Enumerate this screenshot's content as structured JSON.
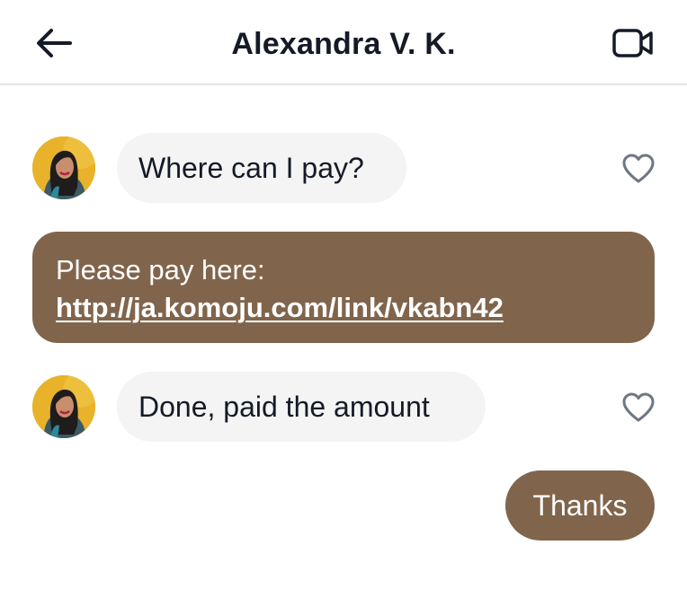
{
  "header": {
    "title": "Alexandra V. K.",
    "back_icon": "arrow-left-icon",
    "video_icon": "video-camera-icon"
  },
  "messages": [
    {
      "direction": "incoming",
      "text": "Where can I pay?"
    },
    {
      "direction": "outgoing",
      "text": "Please pay here:",
      "link": "http://ja.komoju.com/link/vkabn42"
    },
    {
      "direction": "incoming",
      "text": "Done, paid the amount"
    },
    {
      "direction": "outgoing",
      "text": "Thanks"
    }
  ],
  "colors": {
    "outgoing_bubble": "#80654c",
    "incoming_bubble": "#f4f4f5",
    "text": "#141a26",
    "icon": "#6f7782"
  }
}
